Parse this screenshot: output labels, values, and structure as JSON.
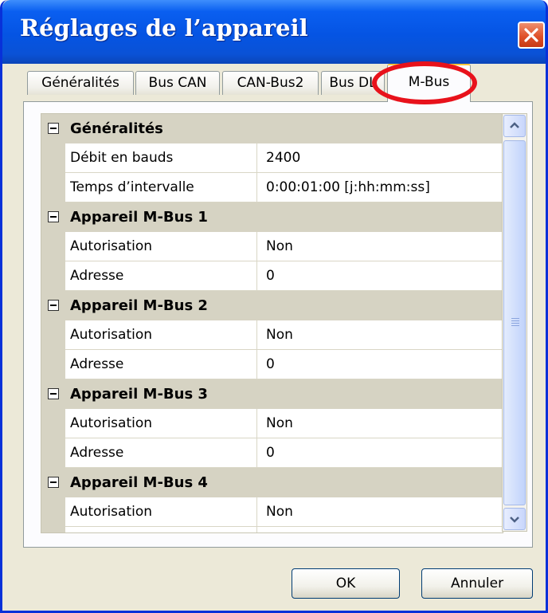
{
  "window": {
    "title": "Réglages de l’appareil",
    "close_icon": "close-icon"
  },
  "tabs": [
    {
      "label": "Généralités",
      "active": false
    },
    {
      "label": "Bus CAN",
      "active": false
    },
    {
      "label": "CAN-Bus2",
      "active": false
    },
    {
      "label": "Bus DL",
      "active": false
    },
    {
      "label": "M-Bus",
      "active": true
    }
  ],
  "grid": {
    "rows": [
      {
        "type": "category",
        "label": "Généralités"
      },
      {
        "type": "property",
        "name": "Débit en bauds",
        "value": "2400"
      },
      {
        "type": "property",
        "name": "Temps d’intervalle",
        "value": "0:00:01:00 [j:hh:mm:ss]"
      },
      {
        "type": "category",
        "label": "Appareil M-Bus 1"
      },
      {
        "type": "property",
        "name": "Autorisation",
        "value": "Non"
      },
      {
        "type": "property",
        "name": "Adresse",
        "value": "0"
      },
      {
        "type": "category",
        "label": "Appareil M-Bus 2"
      },
      {
        "type": "property",
        "name": "Autorisation",
        "value": "Non"
      },
      {
        "type": "property",
        "name": "Adresse",
        "value": "0"
      },
      {
        "type": "category",
        "label": "Appareil M-Bus 3"
      },
      {
        "type": "property",
        "name": "Autorisation",
        "value": "Non"
      },
      {
        "type": "property",
        "name": "Adresse",
        "value": "0"
      },
      {
        "type": "category",
        "label": "Appareil M-Bus 4"
      },
      {
        "type": "property",
        "name": "Autorisation",
        "value": "Non"
      },
      {
        "type": "property",
        "name": "",
        "value": ""
      }
    ]
  },
  "buttons": {
    "ok_label": "OK",
    "cancel_label": "Annuler"
  },
  "colors": {
    "titlebar": "#0554e3",
    "highlight_ring": "#e8121b",
    "category_background": "#d6d3c3"
  }
}
